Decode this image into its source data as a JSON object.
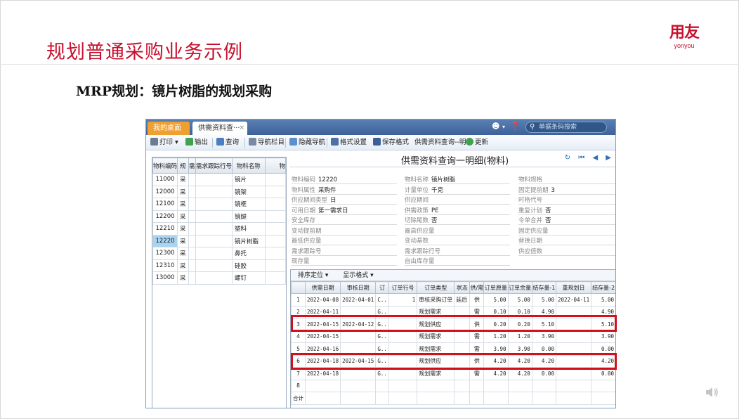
{
  "slide": {
    "title": "规划普通采购业务示例",
    "subtitle": "MRP规划：镜片树脂的规划采购",
    "logo_cn": "用友",
    "logo_en": "yonyou"
  },
  "app": {
    "tabs": [
      {
        "label": "我的桌面"
      },
      {
        "label": "供需资料查···"
      }
    ],
    "tab_close": "×",
    "search_placeholder": "单据条码搜索",
    "toolbar": [
      {
        "label": "打印",
        "icon": "printer-icon"
      },
      {
        "label": "输出",
        "icon": "export-icon"
      },
      {
        "label": "查询",
        "icon": "query-icon"
      },
      {
        "label": "导航栏目",
        "icon": "nav-column-icon"
      },
      {
        "label": "隐藏导航",
        "icon": "hide-nav-icon"
      },
      {
        "label": "格式设置",
        "icon": "format-settings-icon"
      },
      {
        "label": "保存格式",
        "icon": "save-format-icon"
      },
      {
        "label": "供需资料查询--明▾",
        "icon": ""
      },
      {
        "label": "更新",
        "icon": "refresh-icon"
      }
    ],
    "left_table": {
      "headers": [
        "物料编码",
        "规",
        "需",
        "需求跟踪行号",
        "物料名称",
        "物"
      ],
      "rows": [
        {
          "code": "11000",
          "a": "采",
          "name": "镜片"
        },
        {
          "code": "12000",
          "a": "采",
          "name": "镜架"
        },
        {
          "code": "12100",
          "a": "采",
          "name": "镜框"
        },
        {
          "code": "12200",
          "a": "采",
          "name": "镜腿"
        },
        {
          "code": "12210",
          "a": "采",
          "name": "塑料"
        },
        {
          "code": "12220",
          "a": "采",
          "name": "镜片树脂"
        },
        {
          "code": "12300",
          "a": "采",
          "name": "鼻托"
        },
        {
          "code": "12310",
          "a": "采",
          "name": "硅胶"
        },
        {
          "code": "13000",
          "a": "采",
          "name": "螺钉"
        }
      ]
    },
    "detail": {
      "title": "供需资料查询一明细(物料)",
      "nav": "↻ ⏮ ◀ ▶",
      "fields": {
        "c1": [
          {
            "label": "物料编码",
            "value": "12220"
          },
          {
            "label": "物料属性",
            "value": "采购件"
          },
          {
            "label": "供应期间类型",
            "value": "日"
          },
          {
            "label": "可用日期",
            "value": "第一需求日"
          },
          {
            "label": "安全库存",
            "value": ""
          },
          {
            "label": "变动提前期",
            "value": ""
          },
          {
            "label": "最低供应量",
            "value": ""
          },
          {
            "label": "需求跟踪号",
            "value": ""
          },
          {
            "label": "现存量",
            "value": ""
          }
        ],
        "c2": [
          {
            "label": "物料名称",
            "value": "镜片树脂"
          },
          {
            "label": "计量单位",
            "value": "千克"
          },
          {
            "label": "供应期间",
            "value": ""
          },
          {
            "label": "供需政策",
            "value": "PE"
          },
          {
            "label": "切除尾数",
            "value": "否"
          },
          {
            "label": "最高供应量",
            "value": ""
          },
          {
            "label": "变动基数",
            "value": ""
          },
          {
            "label": "需求跟踪行号",
            "value": ""
          },
          {
            "label": "自由库存量",
            "value": ""
          }
        ],
        "c3": [
          {
            "label": "物料规格",
            "value": ""
          },
          {
            "label": "固定提前期",
            "value": "3"
          },
          {
            "label": "时格代号",
            "value": ""
          },
          {
            "label": "重复计划",
            "value": "否"
          },
          {
            "label": "令单合并",
            "value": "否"
          },
          {
            "label": "固定供应量",
            "value": ""
          },
          {
            "label": "替换日期",
            "value": ""
          },
          {
            "label": "供应倍数",
            "value": ""
          }
        ]
      }
    },
    "grid": {
      "toolbar": [
        "排序定位 ▾",
        "显示格式 ▾"
      ],
      "headers": [
        "",
        "供需日期",
        "审核日期",
        "订",
        "订单行号",
        "订单类型",
        "状态",
        "供/需",
        "订单原量",
        "订单余量",
        "结存量-1",
        "重规划日",
        "结存量-2"
      ],
      "rows": [
        [
          "1",
          "2022-04-08",
          "2022-04-01",
          "C..",
          "1",
          "审核采购订单",
          "延后",
          "供",
          "5.00",
          "5.00",
          "5.00",
          "2022-04-11",
          "5.00"
        ],
        [
          "2",
          "2022-04-11",
          "",
          "G..",
          "",
          "规划需求",
          "",
          "需",
          "0.10",
          "0.10",
          "4.90",
          "",
          "4.90"
        ],
        [
          "3",
          "2022-04-15",
          "2022-04-12",
          "G..",
          "",
          "规划供应",
          "",
          "供",
          "0.20",
          "0.20",
          "5.10",
          "",
          "5.10"
        ],
        [
          "4",
          "2022-04-15",
          "",
          "G..",
          "",
          "规划需求",
          "",
          "需",
          "1.20",
          "1.20",
          "3.90",
          "",
          "3.90"
        ],
        [
          "5",
          "2022-04-16",
          "",
          "G..",
          "",
          "规划需求",
          "",
          "需",
          "3.90",
          "3.90",
          "0.00",
          "",
          "0.00"
        ],
        [
          "6",
          "2022-04-18",
          "2022-04-15",
          "G..",
          "",
          "规划供应",
          "",
          "供",
          "4.20",
          "4.20",
          "4.20",
          "",
          "4.20"
        ],
        [
          "7",
          "2022-04-18",
          "",
          "G..",
          "",
          "规划需求",
          "",
          "需",
          "4.20",
          "4.20",
          "0.00",
          "",
          "0.00"
        ],
        [
          "8",
          "",
          "",
          "",
          "",
          "",
          "",
          "",
          "",
          "",
          "",
          "",
          ""
        ],
        [
          "合计",
          "",
          "",
          "",
          "",
          "",
          "",
          "",
          "",
          "",
          "",
          "",
          ""
        ]
      ]
    }
  },
  "colors": {
    "title_red": "#c8102e",
    "highlight_red": "#d0101a",
    "selected_row": "#a8d4f2"
  }
}
